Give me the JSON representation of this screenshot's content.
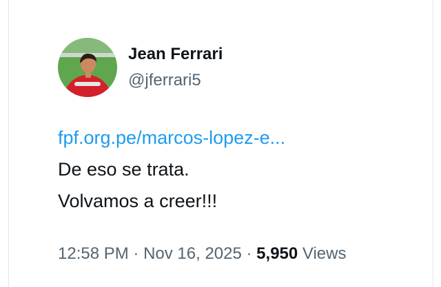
{
  "user": {
    "display_name": "Jean Ferrari",
    "handle": "@jferrari5"
  },
  "tweet": {
    "link_text": "fpf.org.pe/marcos-lopez-e...",
    "line1": "De eso se trata.",
    "line2": "Volvamos a creer!!!"
  },
  "meta": {
    "time": "12:58 PM",
    "sep1": " · ",
    "date": "Nov 16, 2025",
    "sep2": " · ",
    "views_count": "5,950",
    "views_label": " Views"
  },
  "colors": {
    "link": "#1d9bf0",
    "text_primary": "#0f1419",
    "text_secondary": "#536471",
    "avatar_shirt": "#d3202c",
    "avatar_background": "#3f8f3a"
  }
}
